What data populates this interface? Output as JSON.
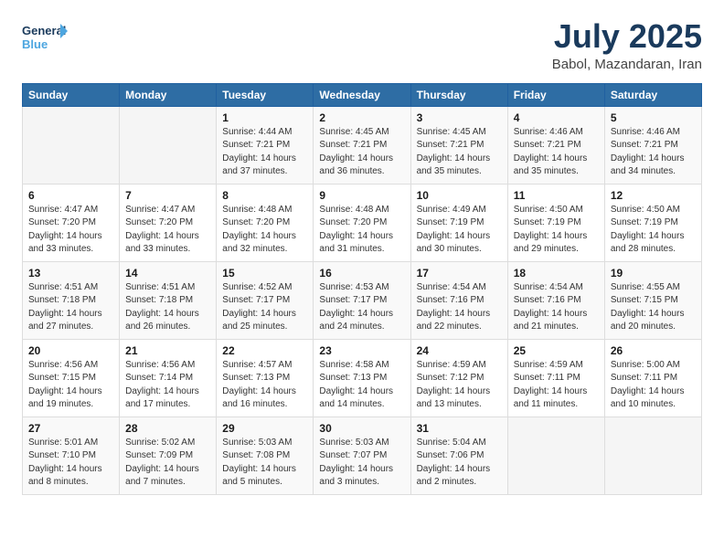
{
  "header": {
    "logo_line1": "General",
    "logo_line2": "Blue",
    "main_title": "July 2025",
    "subtitle": "Babol, Mazandaran, Iran"
  },
  "calendar": {
    "weekdays": [
      "Sunday",
      "Monday",
      "Tuesday",
      "Wednesday",
      "Thursday",
      "Friday",
      "Saturday"
    ],
    "rows": [
      [
        {
          "day": "",
          "info": ""
        },
        {
          "day": "",
          "info": ""
        },
        {
          "day": "1",
          "info": "Sunrise: 4:44 AM\nSunset: 7:21 PM\nDaylight: 14 hours\nand 37 minutes."
        },
        {
          "day": "2",
          "info": "Sunrise: 4:45 AM\nSunset: 7:21 PM\nDaylight: 14 hours\nand 36 minutes."
        },
        {
          "day": "3",
          "info": "Sunrise: 4:45 AM\nSunset: 7:21 PM\nDaylight: 14 hours\nand 35 minutes."
        },
        {
          "day": "4",
          "info": "Sunrise: 4:46 AM\nSunset: 7:21 PM\nDaylight: 14 hours\nand 35 minutes."
        },
        {
          "day": "5",
          "info": "Sunrise: 4:46 AM\nSunset: 7:21 PM\nDaylight: 14 hours\nand 34 minutes."
        }
      ],
      [
        {
          "day": "6",
          "info": "Sunrise: 4:47 AM\nSunset: 7:20 PM\nDaylight: 14 hours\nand 33 minutes."
        },
        {
          "day": "7",
          "info": "Sunrise: 4:47 AM\nSunset: 7:20 PM\nDaylight: 14 hours\nand 33 minutes."
        },
        {
          "day": "8",
          "info": "Sunrise: 4:48 AM\nSunset: 7:20 PM\nDaylight: 14 hours\nand 32 minutes."
        },
        {
          "day": "9",
          "info": "Sunrise: 4:48 AM\nSunset: 7:20 PM\nDaylight: 14 hours\nand 31 minutes."
        },
        {
          "day": "10",
          "info": "Sunrise: 4:49 AM\nSunset: 7:19 PM\nDaylight: 14 hours\nand 30 minutes."
        },
        {
          "day": "11",
          "info": "Sunrise: 4:50 AM\nSunset: 7:19 PM\nDaylight: 14 hours\nand 29 minutes."
        },
        {
          "day": "12",
          "info": "Sunrise: 4:50 AM\nSunset: 7:19 PM\nDaylight: 14 hours\nand 28 minutes."
        }
      ],
      [
        {
          "day": "13",
          "info": "Sunrise: 4:51 AM\nSunset: 7:18 PM\nDaylight: 14 hours\nand 27 minutes."
        },
        {
          "day": "14",
          "info": "Sunrise: 4:51 AM\nSunset: 7:18 PM\nDaylight: 14 hours\nand 26 minutes."
        },
        {
          "day": "15",
          "info": "Sunrise: 4:52 AM\nSunset: 7:17 PM\nDaylight: 14 hours\nand 25 minutes."
        },
        {
          "day": "16",
          "info": "Sunrise: 4:53 AM\nSunset: 7:17 PM\nDaylight: 14 hours\nand 24 minutes."
        },
        {
          "day": "17",
          "info": "Sunrise: 4:54 AM\nSunset: 7:16 PM\nDaylight: 14 hours\nand 22 minutes."
        },
        {
          "day": "18",
          "info": "Sunrise: 4:54 AM\nSunset: 7:16 PM\nDaylight: 14 hours\nand 21 minutes."
        },
        {
          "day": "19",
          "info": "Sunrise: 4:55 AM\nSunset: 7:15 PM\nDaylight: 14 hours\nand 20 minutes."
        }
      ],
      [
        {
          "day": "20",
          "info": "Sunrise: 4:56 AM\nSunset: 7:15 PM\nDaylight: 14 hours\nand 19 minutes."
        },
        {
          "day": "21",
          "info": "Sunrise: 4:56 AM\nSunset: 7:14 PM\nDaylight: 14 hours\nand 17 minutes."
        },
        {
          "day": "22",
          "info": "Sunrise: 4:57 AM\nSunset: 7:13 PM\nDaylight: 14 hours\nand 16 minutes."
        },
        {
          "day": "23",
          "info": "Sunrise: 4:58 AM\nSunset: 7:13 PM\nDaylight: 14 hours\nand 14 minutes."
        },
        {
          "day": "24",
          "info": "Sunrise: 4:59 AM\nSunset: 7:12 PM\nDaylight: 14 hours\nand 13 minutes."
        },
        {
          "day": "25",
          "info": "Sunrise: 4:59 AM\nSunset: 7:11 PM\nDaylight: 14 hours\nand 11 minutes."
        },
        {
          "day": "26",
          "info": "Sunrise: 5:00 AM\nSunset: 7:11 PM\nDaylight: 14 hours\nand 10 minutes."
        }
      ],
      [
        {
          "day": "27",
          "info": "Sunrise: 5:01 AM\nSunset: 7:10 PM\nDaylight: 14 hours\nand 8 minutes."
        },
        {
          "day": "28",
          "info": "Sunrise: 5:02 AM\nSunset: 7:09 PM\nDaylight: 14 hours\nand 7 minutes."
        },
        {
          "day": "29",
          "info": "Sunrise: 5:03 AM\nSunset: 7:08 PM\nDaylight: 14 hours\nand 5 minutes."
        },
        {
          "day": "30",
          "info": "Sunrise: 5:03 AM\nSunset: 7:07 PM\nDaylight: 14 hours\nand 3 minutes."
        },
        {
          "day": "31",
          "info": "Sunrise: 5:04 AM\nSunset: 7:06 PM\nDaylight: 14 hours\nand 2 minutes."
        },
        {
          "day": "",
          "info": ""
        },
        {
          "day": "",
          "info": ""
        }
      ]
    ]
  }
}
